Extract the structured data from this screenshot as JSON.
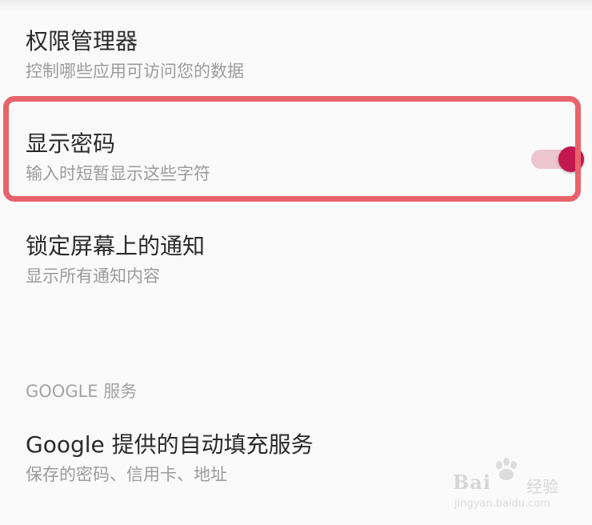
{
  "settings": {
    "permission_manager": {
      "title": "权限管理器",
      "summary": "控制哪些应用可访问您的数据"
    },
    "show_password": {
      "title": "显示密码",
      "summary": "输入时短暂显示这些字符",
      "enabled": true
    },
    "lockscreen_notifications": {
      "title": "锁定屏幕上的通知",
      "summary": "显示所有通知内容"
    }
  },
  "google_section": {
    "header": "GOOGLE 服务",
    "autofill": {
      "title": "Google 提供的自动填充服务",
      "summary": "保存的密码、信用卡、地址"
    }
  },
  "watermark": {
    "brand": "Bai",
    "brand_suffix": "经验",
    "url": "jingyan.baidu.com",
    "icon": "paw-icon"
  },
  "colors": {
    "highlight": "#e8636c",
    "toggle_thumb": "#c2184f",
    "toggle_track": "#ecc5cf"
  }
}
